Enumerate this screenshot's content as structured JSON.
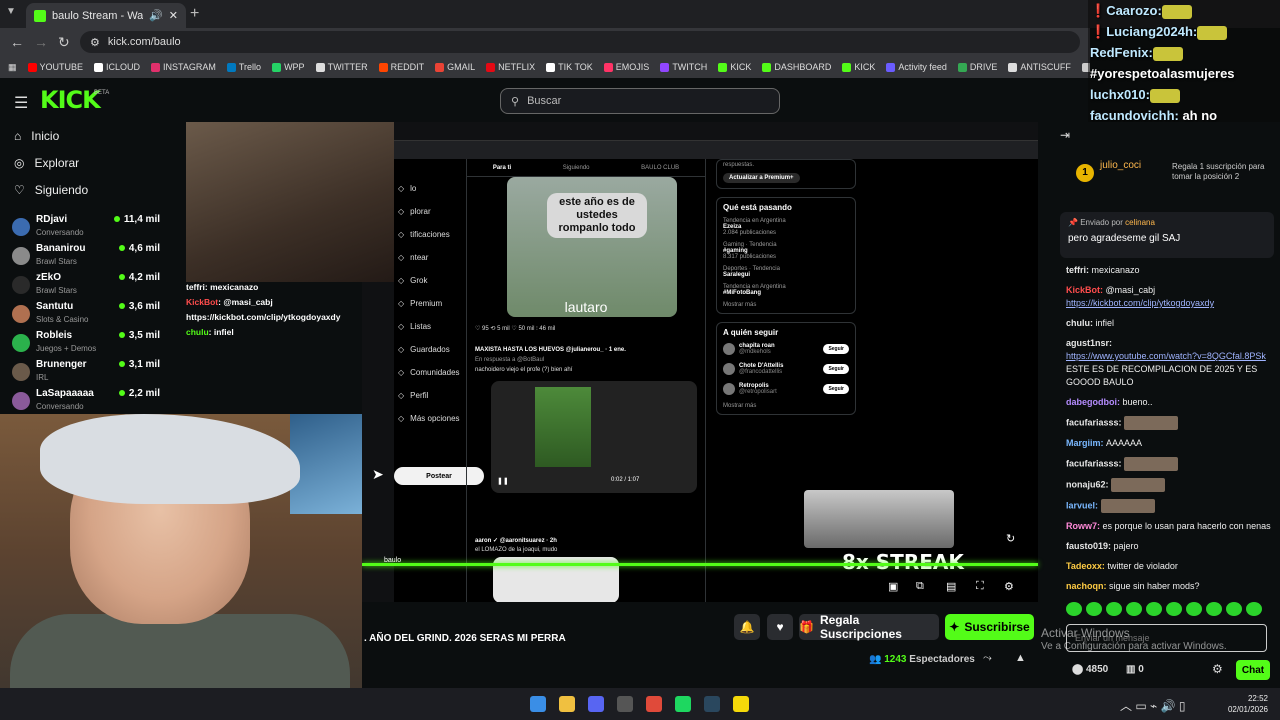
{
  "browser": {
    "tab_title": "baulo Stream - Watch Live",
    "new_tab": "+",
    "url": "kick.com/baulo",
    "bookmarks": [
      {
        "label": "YOUTUBE",
        "color": "#ff0000"
      },
      {
        "label": "ICLOUD",
        "color": "#ffffff"
      },
      {
        "label": "INSTAGRAM",
        "color": "#e1306c"
      },
      {
        "label": "Trello",
        "color": "#0079bf"
      },
      {
        "label": "WPP",
        "color": "#25d366"
      },
      {
        "label": "TWITTER",
        "color": "#dddddd"
      },
      {
        "label": "REDDIT",
        "color": "#ff4500"
      },
      {
        "label": "GMAIL",
        "color": "#ea4335"
      },
      {
        "label": "NETFLIX",
        "color": "#e50914"
      },
      {
        "label": "TIK TOK",
        "color": "#ffffff"
      },
      {
        "label": "EMOJIS",
        "color": "#ff3366"
      },
      {
        "label": "TWITCH",
        "color": "#9146ff"
      },
      {
        "label": "KICK",
        "color": "#53fc18"
      },
      {
        "label": "DASHBOARD",
        "color": "#53fc18"
      },
      {
        "label": "KICK",
        "color": "#53fc18"
      },
      {
        "label": "Activity feed",
        "color": "#6a5cff"
      },
      {
        "label": "DRIVE",
        "color": "#34a853"
      },
      {
        "label": "ANTISCUFF",
        "color": "#dddddd"
      },
      {
        "label": "FUENTES",
        "color": "#cccccc"
      }
    ]
  },
  "overlay_chat": [
    {
      "name": "Caarozo:",
      "red": true
    },
    {
      "name": "Luciang2024h:",
      "red": true
    },
    {
      "name": "RedFenix:",
      "red": false,
      "msg": ""
    },
    {
      "name": "",
      "red": false,
      "msg": "#yorespetoalasmujeres"
    },
    {
      "name": "luchx010:",
      "red": false,
      "msg": ""
    },
    {
      "name": "facundovichh:",
      "red": false,
      "msg": "ah no"
    }
  ],
  "header": {
    "logo": "KICK",
    "beta": "BETA",
    "search_placeholder": "Buscar"
  },
  "sidebar": {
    "nav": [
      {
        "label": "Inicio",
        "icon": "home-icon"
      },
      {
        "label": "Explorar",
        "icon": "compass-icon"
      },
      {
        "label": "Siguiendo",
        "icon": "heart-icon"
      }
    ],
    "channels": [
      {
        "name": "RDjavi",
        "category": "Conversando",
        "viewers": "11,4 mil",
        "color": "#3b6bb0"
      },
      {
        "name": "Bananirou",
        "category": "Brawl Stars",
        "viewers": "4,6 mil",
        "color": "#8a8a8a"
      },
      {
        "name": "zEkO",
        "category": "Brawl Stars",
        "viewers": "4,2 mil",
        "color": "#2a2a2a"
      },
      {
        "name": "Santutu",
        "category": "Slots & Casino",
        "viewers": "3,6 mil",
        "color": "#b07050"
      },
      {
        "name": "Robleis",
        "category": "Juegos + Demos",
        "viewers": "3,5 mil",
        "color": "#2bb24c"
      },
      {
        "name": "Brunenger",
        "category": "IRL",
        "viewers": "3,1 mil",
        "color": "#6a5a4a"
      },
      {
        "name": "LaSapaaaaa",
        "category": "Conversando",
        "viewers": "2,2 mil",
        "color": "#8a5a9a"
      }
    ]
  },
  "stream": {
    "small_chat": [
      {
        "name": "teffri",
        "msg": ": mexicanazo",
        "kind": "plain"
      },
      {
        "name": "KickBot",
        "msg": ": @masi_cabj",
        "kind": "bot"
      },
      {
        "name": "",
        "msg": "https://kickbot.com/clip/ytkogdoyaxdy",
        "kind": "plain"
      },
      {
        "name": "chulu",
        "msg": ": infiel",
        "kind": "green"
      }
    ],
    "x_nav": [
      "lo",
      "plorar",
      "tificaciones",
      "ntear",
      "Grok",
      "Premium",
      "Listas",
      "Guardados",
      "Comunidades",
      "Perfil",
      "Más opciones"
    ],
    "x_post_button": "Postear",
    "feed_tabs": [
      "Para ti",
      "Siguiendo",
      "BAULO CLUB"
    ],
    "post1_bubble": "este año es de ustedes rompanlo todo",
    "post1_caption": "lautaro",
    "post1_meta": "♡ 95        ⟲ 5 mil        ♡ 50 mil        ⫶ 46 mil",
    "post2_author": "MAXISTA HASTA LOS HUEVOS @julianerou_ · 1 ene.",
    "post2_reply": "En respuesta a @BotBaul",
    "post2_text": "nachoidero viejo el profe (?) bien ahí",
    "post2_time": "0:02 / 1:07",
    "post3_author": "aaron ✓ @aaronitsuarez · 2h",
    "post3_text": "el LOMAZO de la joaqui, mudo",
    "premium_text": "respuestas.",
    "premium_btn": "Actualizar a Premium+",
    "trending_title": "Qué está pasando",
    "trends": [
      {
        "ctx": "Tendencia en Argentina",
        "name": "Ezeiza",
        "count": "2.084 publicaciones"
      },
      {
        "ctx": "Gaming · Tendencia",
        "name": "#gaming",
        "count": "8.317 publicaciones"
      },
      {
        "ctx": "Deportes · Tendencia",
        "name": "Saralegui",
        "count": ""
      },
      {
        "ctx": "Tendencia en Argentina",
        "name": "#MiFotoBang",
        "count": ""
      }
    ],
    "show_more": "Mostrar más",
    "follow_title": "A quién seguir",
    "follows": [
      {
        "name": "chapita roan",
        "handle": "@mdkehols"
      },
      {
        "name": "Chote D'Attellis",
        "handle": "@francodattellis"
      },
      {
        "name": "Retropolis",
        "handle": "@retropolisart"
      }
    ],
    "follow_btn": "Seguir",
    "streak": "8x STREAK",
    "streamer_tag": "baulo"
  },
  "below_video": {
    "ticker": ". AÑO DEL GRIND. 2026 SERAS MI PERRA",
    "gift_label": "Regala Suscripciones",
    "sub_label": "Suscribirse",
    "viewers_count": "1243",
    "viewers_label": "Espectadores"
  },
  "chat": {
    "title": "Chat",
    "gift_user": "julio_coci",
    "gift_rank": "1",
    "gift_desc": "Regala 1 suscripción para tomar la posición 2",
    "pinned_by_label": "Enviado por",
    "pinned_by": "celinana",
    "pinned_msg": "pero agradeseme gil SAJ",
    "messages": [
      {
        "user": "teffri:",
        "color": "#e6e6e6",
        "text": "mexicanazo"
      },
      {
        "user": "KickBot:",
        "color": "#ff4d4d",
        "text": "@masi_cabj",
        "link": "https://kickbot.com/clip/ytkogdoyaxdy"
      },
      {
        "user": "chulu:",
        "color": "#e6e6e6",
        "text": "infiel"
      },
      {
        "user": "agust1nsr:",
        "color": "#e6e6e6",
        "link": "https://www.youtube.com/watch?v=8QGCfal.8PSk",
        "text2": "ESTE ES DE RECOMPILACION DE 2025 Y ES GOOOD BAULO"
      },
      {
        "user": "dabegodboi:",
        "color": "#b58cff",
        "text": "bueno.."
      },
      {
        "user": "facufariasss:",
        "color": "#e6e6e6",
        "emote": true
      },
      {
        "user": "Margiim:",
        "color": "#7ab8ff",
        "text": "AAAAAA"
      },
      {
        "user": "facufariasss:",
        "color": "#e6e6e6",
        "emote": true
      },
      {
        "user": "nonaju62:",
        "color": "#e6e6e6",
        "emote": true
      },
      {
        "user": "larvuel:",
        "color": "#7ab8ff",
        "emote": true
      },
      {
        "user": "Roww7:",
        "color": "#ff8ad8",
        "text": "es porque lo usan para hacerlo con nenas"
      },
      {
        "user": "fausto019:",
        "color": "#e6e6e6",
        "text": "pajero"
      },
      {
        "user": "Tadeoxx:",
        "color": "#ffcc44",
        "text": "twitter de violador"
      },
      {
        "user": "nachoqn:",
        "color": "#ffcc44",
        "text": "sigue sin haber mods?"
      }
    ],
    "input_placeholder": "Enviar un mensaje",
    "points": "4850",
    "chest": "0",
    "send_label": "Chat",
    "watermark_title": "Activar Windows",
    "watermark_sub": "Ve a Configuración para activar Windows."
  },
  "taskbar": {
    "time": "22:52",
    "date": "02/01/2026",
    "apps": [
      {
        "name": "start",
        "color": "#3a8ee6"
      },
      {
        "name": "files",
        "color": "#f0c040"
      },
      {
        "name": "discord",
        "color": "#5865f2"
      },
      {
        "name": "obs",
        "color": "#555555"
      },
      {
        "name": "chrome",
        "color": "#e04a3a"
      },
      {
        "name": "spotify",
        "color": "#1ed760"
      },
      {
        "name": "steam",
        "color": "#2a475e"
      },
      {
        "name": "notes",
        "color": "#f5d90a"
      }
    ]
  }
}
